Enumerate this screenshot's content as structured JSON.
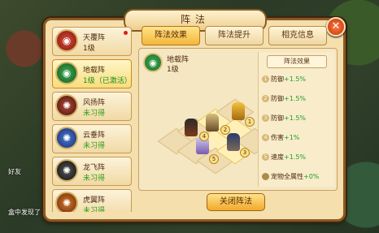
{
  "dialog": {
    "title": "阵法"
  },
  "tabs": [
    {
      "label": "阵法效果",
      "active": true
    },
    {
      "label": "阵法提升",
      "active": false
    },
    {
      "label": "相克信息",
      "active": false
    }
  ],
  "formations": [
    {
      "name": "天覆阵",
      "status": "1级",
      "symbol": "◉",
      "color": "#c0392b",
      "notify": true
    },
    {
      "name": "地载阵",
      "status": "1级（已激活）",
      "symbol": "◉",
      "color": "#1f8a36",
      "active": true
    },
    {
      "name": "风扬阵",
      "status": "未习得",
      "symbol": "✺",
      "color": "#8a2a1e"
    },
    {
      "name": "云垂阵",
      "status": "未习得",
      "symbol": "✺",
      "color": "#2a4da8"
    },
    {
      "name": "龙飞阵",
      "status": "未习得",
      "symbol": "✺",
      "color": "#222222"
    },
    {
      "name": "虎翼阵",
      "status": "未习得",
      "symbol": "✺",
      "color": "#b2501a"
    }
  ],
  "selected": {
    "name": "地载阵",
    "level": "1级"
  },
  "effects": {
    "title": "阵法效果",
    "rows": [
      {
        "num": "1",
        "label": "防御",
        "value": "+1.5%"
      },
      {
        "num": "2",
        "label": "防御",
        "value": "+1.5%"
      },
      {
        "num": "3",
        "label": "防御",
        "value": "+1.5%"
      },
      {
        "num": "4",
        "label": "伤害",
        "value": "+1%"
      },
      {
        "num": "5",
        "label": "速度",
        "value": "+1.5%"
      },
      {
        "num": "",
        "label": "宠物全属性",
        "value": "+0%"
      }
    ]
  },
  "slots": [
    "1",
    "2",
    "3",
    "4",
    "5"
  ],
  "buttons": {
    "close_formation": "关闭阵法",
    "close": "✕"
  },
  "scene": {
    "left_label_1": "好友",
    "left_label_2": "盒中发现了"
  }
}
